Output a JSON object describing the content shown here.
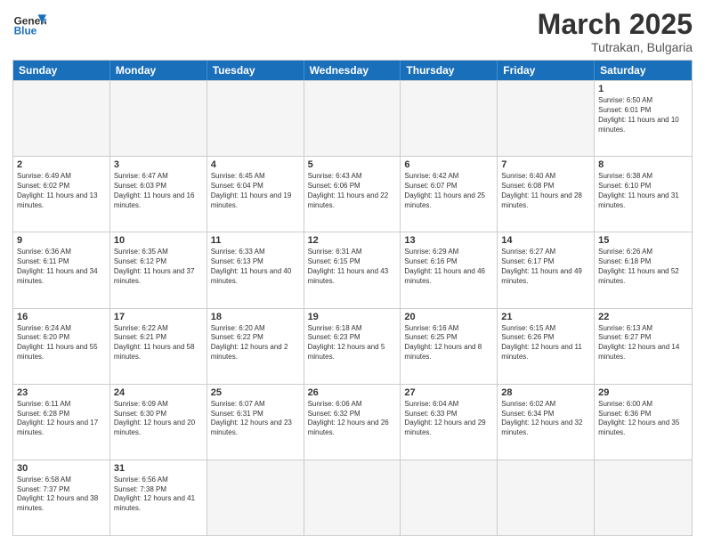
{
  "header": {
    "logo_general": "General",
    "logo_blue": "Blue",
    "month_title": "March 2025",
    "subtitle": "Tutrakan, Bulgaria"
  },
  "weekdays": [
    "Sunday",
    "Monday",
    "Tuesday",
    "Wednesday",
    "Thursday",
    "Friday",
    "Saturday"
  ],
  "rows": [
    [
      {
        "day": "",
        "info": ""
      },
      {
        "day": "",
        "info": ""
      },
      {
        "day": "",
        "info": ""
      },
      {
        "day": "",
        "info": ""
      },
      {
        "day": "",
        "info": ""
      },
      {
        "day": "",
        "info": ""
      },
      {
        "day": "1",
        "info": "Sunrise: 6:50 AM\nSunset: 6:01 PM\nDaylight: 11 hours and 10 minutes."
      }
    ],
    [
      {
        "day": "2",
        "info": "Sunrise: 6:49 AM\nSunset: 6:02 PM\nDaylight: 11 hours and 13 minutes."
      },
      {
        "day": "3",
        "info": "Sunrise: 6:47 AM\nSunset: 6:03 PM\nDaylight: 11 hours and 16 minutes."
      },
      {
        "day": "4",
        "info": "Sunrise: 6:45 AM\nSunset: 6:04 PM\nDaylight: 11 hours and 19 minutes."
      },
      {
        "day": "5",
        "info": "Sunrise: 6:43 AM\nSunset: 6:06 PM\nDaylight: 11 hours and 22 minutes."
      },
      {
        "day": "6",
        "info": "Sunrise: 6:42 AM\nSunset: 6:07 PM\nDaylight: 11 hours and 25 minutes."
      },
      {
        "day": "7",
        "info": "Sunrise: 6:40 AM\nSunset: 6:08 PM\nDaylight: 11 hours and 28 minutes."
      },
      {
        "day": "8",
        "info": "Sunrise: 6:38 AM\nSunset: 6:10 PM\nDaylight: 11 hours and 31 minutes."
      }
    ],
    [
      {
        "day": "9",
        "info": "Sunrise: 6:36 AM\nSunset: 6:11 PM\nDaylight: 11 hours and 34 minutes."
      },
      {
        "day": "10",
        "info": "Sunrise: 6:35 AM\nSunset: 6:12 PM\nDaylight: 11 hours and 37 minutes."
      },
      {
        "day": "11",
        "info": "Sunrise: 6:33 AM\nSunset: 6:13 PM\nDaylight: 11 hours and 40 minutes."
      },
      {
        "day": "12",
        "info": "Sunrise: 6:31 AM\nSunset: 6:15 PM\nDaylight: 11 hours and 43 minutes."
      },
      {
        "day": "13",
        "info": "Sunrise: 6:29 AM\nSunset: 6:16 PM\nDaylight: 11 hours and 46 minutes."
      },
      {
        "day": "14",
        "info": "Sunrise: 6:27 AM\nSunset: 6:17 PM\nDaylight: 11 hours and 49 minutes."
      },
      {
        "day": "15",
        "info": "Sunrise: 6:26 AM\nSunset: 6:18 PM\nDaylight: 11 hours and 52 minutes."
      }
    ],
    [
      {
        "day": "16",
        "info": "Sunrise: 6:24 AM\nSunset: 6:20 PM\nDaylight: 11 hours and 55 minutes."
      },
      {
        "day": "17",
        "info": "Sunrise: 6:22 AM\nSunset: 6:21 PM\nDaylight: 11 hours and 58 minutes."
      },
      {
        "day": "18",
        "info": "Sunrise: 6:20 AM\nSunset: 6:22 PM\nDaylight: 12 hours and 2 minutes."
      },
      {
        "day": "19",
        "info": "Sunrise: 6:18 AM\nSunset: 6:23 PM\nDaylight: 12 hours and 5 minutes."
      },
      {
        "day": "20",
        "info": "Sunrise: 6:16 AM\nSunset: 6:25 PM\nDaylight: 12 hours and 8 minutes."
      },
      {
        "day": "21",
        "info": "Sunrise: 6:15 AM\nSunset: 6:26 PM\nDaylight: 12 hours and 11 minutes."
      },
      {
        "day": "22",
        "info": "Sunrise: 6:13 AM\nSunset: 6:27 PM\nDaylight: 12 hours and 14 minutes."
      }
    ],
    [
      {
        "day": "23",
        "info": "Sunrise: 6:11 AM\nSunset: 6:28 PM\nDaylight: 12 hours and 17 minutes."
      },
      {
        "day": "24",
        "info": "Sunrise: 6:09 AM\nSunset: 6:30 PM\nDaylight: 12 hours and 20 minutes."
      },
      {
        "day": "25",
        "info": "Sunrise: 6:07 AM\nSunset: 6:31 PM\nDaylight: 12 hours and 23 minutes."
      },
      {
        "day": "26",
        "info": "Sunrise: 6:06 AM\nSunset: 6:32 PM\nDaylight: 12 hours and 26 minutes."
      },
      {
        "day": "27",
        "info": "Sunrise: 6:04 AM\nSunset: 6:33 PM\nDaylight: 12 hours and 29 minutes."
      },
      {
        "day": "28",
        "info": "Sunrise: 6:02 AM\nSunset: 6:34 PM\nDaylight: 12 hours and 32 minutes."
      },
      {
        "day": "29",
        "info": "Sunrise: 6:00 AM\nSunset: 6:36 PM\nDaylight: 12 hours and 35 minutes."
      }
    ],
    [
      {
        "day": "30",
        "info": "Sunrise: 6:58 AM\nSunset: 7:37 PM\nDaylight: 12 hours and 38 minutes."
      },
      {
        "day": "31",
        "info": "Sunrise: 6:56 AM\nSunset: 7:38 PM\nDaylight: 12 hours and 41 minutes."
      },
      {
        "day": "",
        "info": ""
      },
      {
        "day": "",
        "info": ""
      },
      {
        "day": "",
        "info": ""
      },
      {
        "day": "",
        "info": ""
      },
      {
        "day": "",
        "info": ""
      }
    ]
  ]
}
